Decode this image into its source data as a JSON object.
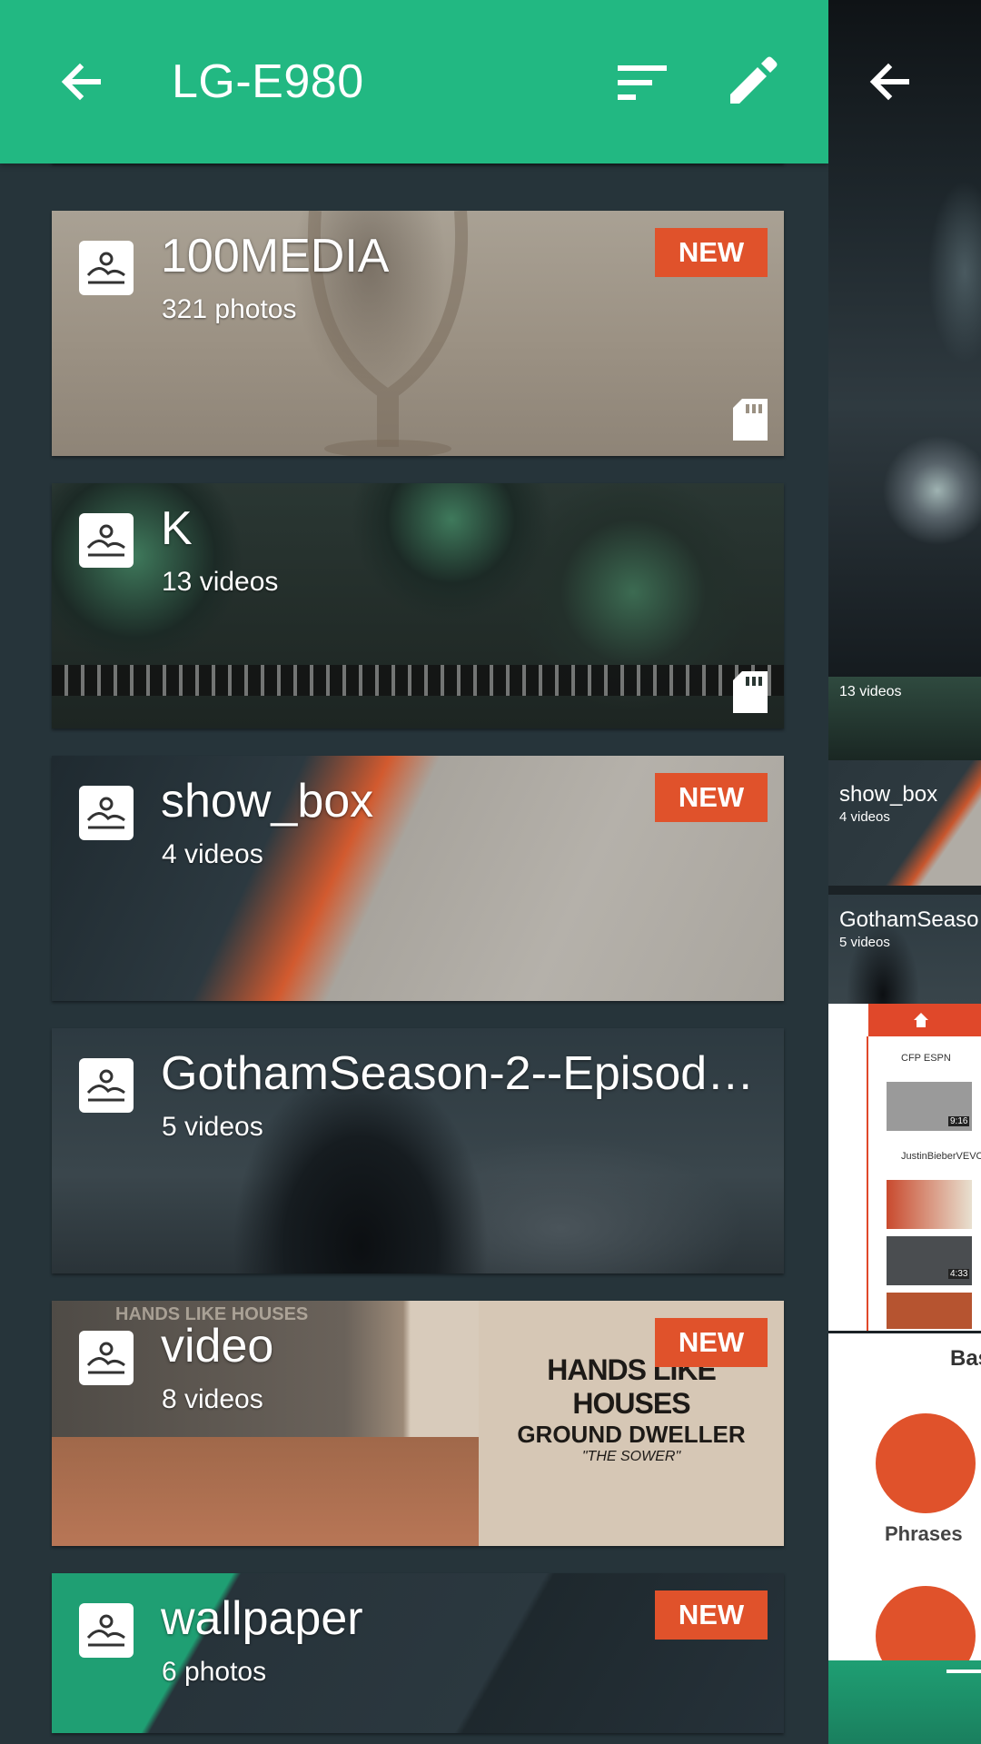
{
  "appbar": {
    "title": "LG-E980",
    "back_icon": "arrow-back-icon",
    "sort_icon": "sort-icon",
    "edit_icon": "pencil-icon",
    "color": "#22b882"
  },
  "albums": [
    {
      "name": "100MEDIA",
      "count": "321 photos",
      "badge": "NEW",
      "sd_card": true
    },
    {
      "name": "K",
      "count": "13 videos",
      "badge": "",
      "sd_card": true
    },
    {
      "name": "show_box",
      "count": "4 videos",
      "badge": "NEW",
      "sd_card": false
    },
    {
      "name": "GothamSeason-2--Episode-...",
      "count": "5 videos",
      "badge": "",
      "sd_card": false
    },
    {
      "name": "video",
      "count": "8 videos",
      "badge": "NEW",
      "sd_card": false
    },
    {
      "name": "wallpaper",
      "count": "6 photos",
      "badge": "NEW",
      "sd_card": false
    }
  ],
  "thumbnail_text": {
    "video_poster": [
      "HANDS LIKE HOUSES",
      "GROUND DWELLER",
      "\"THE SOWER\""
    ],
    "video_poster_top": "HANDS LIKE HOUSES"
  },
  "preview_pane": {
    "back_icon": "arrow-back-icon",
    "k_count": "13 videos",
    "show_box_name": "show_box",
    "show_box_count": "4 videos",
    "gotham_name": "GothamSeaso",
    "gotham_count": "5 videos",
    "app_labels": [
      "CFP ESPN",
      "JustinBieberVEVO"
    ],
    "durations": [
      "9:16",
      "4:33"
    ],
    "phrases_label": "Phrases",
    "bas_label": "Bas"
  },
  "colors": {
    "badge": "#e0522b",
    "background": "#26343a"
  }
}
